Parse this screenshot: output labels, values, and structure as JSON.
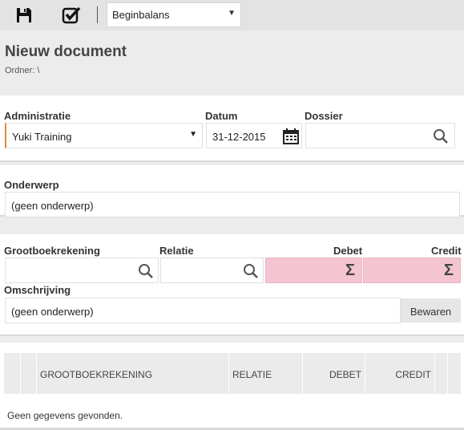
{
  "toolbar": {
    "save_icon": "floppy-disk-icon",
    "check_icon": "checkbox-check-icon",
    "doctype_selected": "Beginbalans"
  },
  "header": {
    "title": "Nieuw document",
    "folder": "Ordner: \\"
  },
  "form": {
    "administratie_label": "Administratie",
    "administratie_value": "Yuki Training",
    "datum_label": "Datum",
    "datum_value": "31-12-2015",
    "dossier_label": "Dossier",
    "dossier_value": "",
    "onderwerp_label": "Onderwerp",
    "onderwerp_value": "(geen onderwerp)"
  },
  "entry": {
    "grootboek_label": "Grootboekrekening",
    "relatie_label": "Relatie",
    "debet_label": "Debet",
    "credit_label": "Credit",
    "omschrijving_label": "Omschrijving",
    "omschrijving_value": "(geen onderwerp)",
    "save_button": "Bewaren",
    "highlight_color": "#f4c5d0"
  },
  "grid": {
    "columns": [
      "GROOTBOEKREKENING",
      "RELATIE",
      "DEBET",
      "CREDIT"
    ],
    "empty_text": "Geen gegevens gevonden."
  }
}
